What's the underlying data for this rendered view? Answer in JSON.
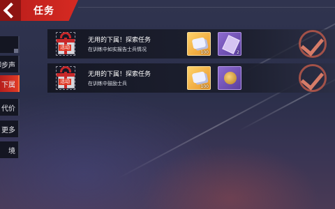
{
  "header": {
    "title": "任务"
  },
  "side_tabs": [
    {
      "label": "脚步声",
      "active": false
    },
    {
      "label": "下属",
      "active": true
    },
    {
      "label": "代价",
      "active": false
    },
    {
      "label": "更多",
      "active": false
    },
    {
      "label": "境",
      "active": false
    }
  ],
  "tasks": [
    {
      "badge": "活动",
      "title": "无用的下属！探索任务",
      "desc": "在训练中如实报告士兵情况",
      "rewards": [
        {
          "icon": "cards-icon",
          "qty": "100"
        },
        {
          "icon": "scroll-icon",
          "qty": "2"
        }
      ]
    },
    {
      "badge": "活动",
      "title": "无用的下属！探索任务",
      "desc": "在训练中鼓励士兵",
      "rewards": [
        {
          "icon": "cards-icon",
          "qty": "100"
        },
        {
          "icon": "gold-bag-icon",
          "qty": ""
        }
      ]
    }
  ],
  "colors": {
    "accent": "#d62a22",
    "check": "#d77c68"
  }
}
